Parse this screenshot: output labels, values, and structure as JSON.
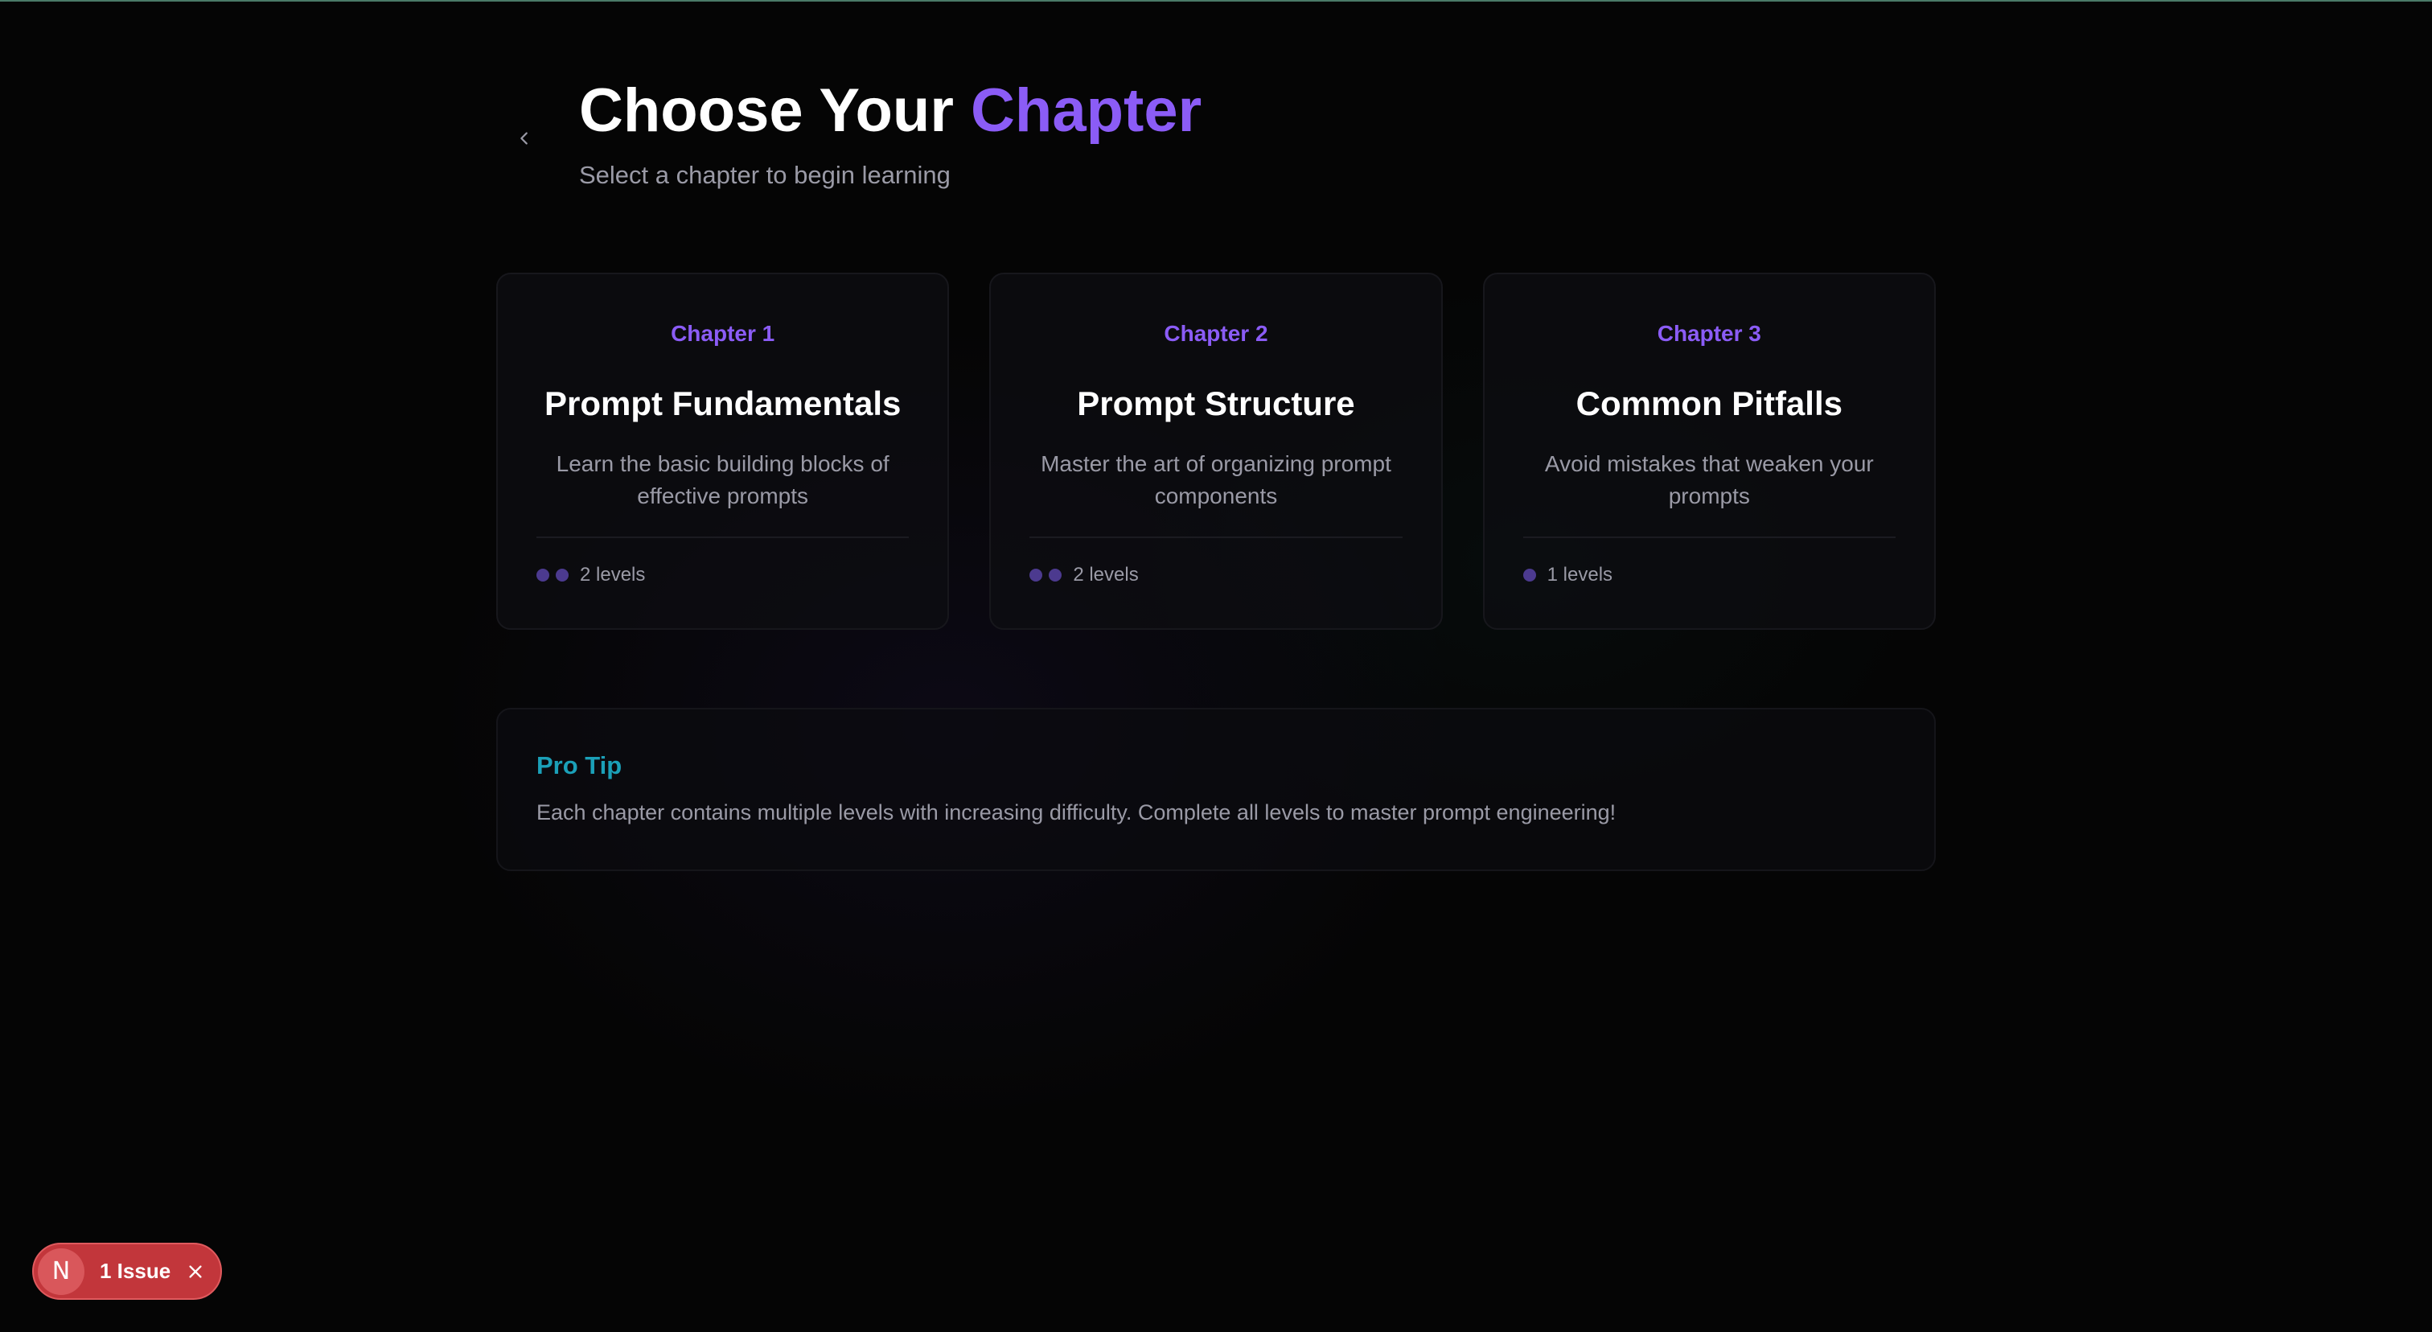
{
  "header": {
    "title_main": "Choose Your ",
    "title_accent": "Chapter",
    "subtitle": "Select a chapter to begin learning",
    "back_icon": "chevron-left-icon"
  },
  "chapters": [
    {
      "chapter_label": "Chapter 1",
      "title": "Prompt Fundamentals",
      "description": "Learn the basic building blocks of effective prompts",
      "level_count": 2,
      "levels_label": "2 levels"
    },
    {
      "chapter_label": "Chapter 2",
      "title": "Prompt Structure",
      "description": "Master the art of organizing prompt components",
      "level_count": 2,
      "levels_label": "2 levels"
    },
    {
      "chapter_label": "Chapter 3",
      "title": "Common Pitfalls",
      "description": "Avoid mistakes that weaken your prompts",
      "level_count": 1,
      "levels_label": "1 levels"
    }
  ],
  "tip": {
    "title": "Pro Tip",
    "text": "Each chapter contains multiple levels with increasing difficulty. Complete all levels to master prompt engineering!"
  },
  "dev_badge": {
    "logo_letter": "N",
    "label": "1 Issue",
    "close_icon": "close-icon"
  },
  "colors": {
    "accent": "#8b5cf6",
    "tip_accent": "#1ba0b8",
    "badge": "#c2363b",
    "level_dot": "#4c3a8f",
    "background": "#050505"
  }
}
